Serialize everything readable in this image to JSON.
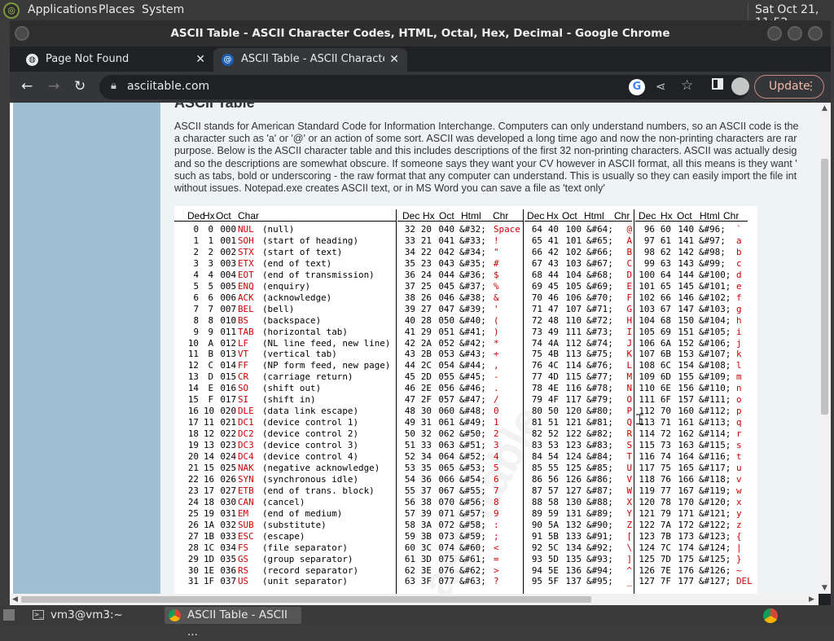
{
  "desktop": {
    "menus": [
      "Applications",
      "Places",
      "System"
    ],
    "clock": "Sat Oct 21, 11:52"
  },
  "window": {
    "title": "ASCII Table - ASCII Character Codes, HTML, Octal, Hex, Decimal - Google Chrome"
  },
  "tabs": [
    {
      "label": "Page Not Found",
      "close": "✕"
    },
    {
      "label": "ASCII Table - ASCII Character C",
      "close": "✕"
    }
  ],
  "newtab": "+",
  "omnibox": {
    "url": "asciitable.com"
  },
  "update_label": "Update",
  "page": {
    "heading": "ASCII Table",
    "intro": [
      "ASCII stands for American Standard Code for Information Interchange. Computers can only understand numbers, so an ASCII code is the",
      "a character such as 'a' or '@' or an action of some sort. ASCII was developed a long time ago and now the non-printing characters are rar",
      "purpose. Below is the ASCII character table and this includes descriptions of the first 32 non-printing characters. ASCII was actually desig",
      "and so the descriptions are somewhat obscure. If someone says they want your CV however in ASCII format, all this means is they want '",
      "such as tabs, bold or underscoring - the raw format that any computer can understand. This is usually so they can easily import the file int",
      "without issues. Notepad.exe creates ASCII text, or in MS Word you can save a file as 'text only'"
    ],
    "headers": [
      [
        "Dec",
        "Hx",
        "Oct",
        "Char"
      ],
      [
        "Dec",
        "Hx",
        "Oct",
        "Html",
        "Chr"
      ],
      [
        "Dec",
        "Hx",
        "Oct",
        "Html",
        "Chr"
      ],
      [
        "Dec",
        "Hx",
        "Oct",
        "Html",
        "Chr"
      ]
    ],
    "col1": [
      [
        "0",
        "0",
        "000",
        "NUL",
        "(null)"
      ],
      [
        "1",
        "1",
        "001",
        "SOH",
        "(start of heading)"
      ],
      [
        "2",
        "2",
        "002",
        "STX",
        "(start of text)"
      ],
      [
        "3",
        "3",
        "003",
        "ETX",
        "(end of text)"
      ],
      [
        "4",
        "4",
        "004",
        "EOT",
        "(end of transmission)"
      ],
      [
        "5",
        "5",
        "005",
        "ENQ",
        "(enquiry)"
      ],
      [
        "6",
        "6",
        "006",
        "ACK",
        "(acknowledge)"
      ],
      [
        "7",
        "7",
        "007",
        "BEL",
        "(bell)"
      ],
      [
        "8",
        "8",
        "010",
        "BS",
        "(backspace)"
      ],
      [
        "9",
        "9",
        "011",
        "TAB",
        "(horizontal tab)"
      ],
      [
        "10",
        "A",
        "012",
        "LF",
        "(NL line feed, new line)"
      ],
      [
        "11",
        "B",
        "013",
        "VT",
        "(vertical tab)"
      ],
      [
        "12",
        "C",
        "014",
        "FF",
        "(NP form feed, new page)"
      ],
      [
        "13",
        "D",
        "015",
        "CR",
        "(carriage return)"
      ],
      [
        "14",
        "E",
        "016",
        "SO",
        "(shift out)"
      ],
      [
        "15",
        "F",
        "017",
        "SI",
        "(shift in)"
      ],
      [
        "16",
        "10",
        "020",
        "DLE",
        "(data link escape)"
      ],
      [
        "17",
        "11",
        "021",
        "DC1",
        "(device control 1)"
      ],
      [
        "18",
        "12",
        "022",
        "DC2",
        "(device control 2)"
      ],
      [
        "19",
        "13",
        "023",
        "DC3",
        "(device control 3)"
      ],
      [
        "20",
        "14",
        "024",
        "DC4",
        "(device control 4)"
      ],
      [
        "21",
        "15",
        "025",
        "NAK",
        "(negative acknowledge)"
      ],
      [
        "22",
        "16",
        "026",
        "SYN",
        "(synchronous idle)"
      ],
      [
        "23",
        "17",
        "027",
        "ETB",
        "(end of trans. block)"
      ],
      [
        "24",
        "18",
        "030",
        "CAN",
        "(cancel)"
      ],
      [
        "25",
        "19",
        "031",
        "EM",
        "(end of medium)"
      ],
      [
        "26",
        "1A",
        "032",
        "SUB",
        "(substitute)"
      ],
      [
        "27",
        "1B",
        "033",
        "ESC",
        "(escape)"
      ],
      [
        "28",
        "1C",
        "034",
        "FS",
        "(file separator)"
      ],
      [
        "29",
        "1D",
        "035",
        "GS",
        "(group separator)"
      ],
      [
        "30",
        "1E",
        "036",
        "RS",
        "(record separator)"
      ],
      [
        "31",
        "1F",
        "037",
        "US",
        "(unit separator)"
      ]
    ],
    "col2": [
      [
        "32",
        "20",
        "040",
        "&#32;",
        "Space"
      ],
      [
        "33",
        "21",
        "041",
        "&#33;",
        "!"
      ],
      [
        "34",
        "22",
        "042",
        "&#34;",
        "\""
      ],
      [
        "35",
        "23",
        "043",
        "&#35;",
        "#"
      ],
      [
        "36",
        "24",
        "044",
        "&#36;",
        "$"
      ],
      [
        "37",
        "25",
        "045",
        "&#37;",
        "%"
      ],
      [
        "38",
        "26",
        "046",
        "&#38;",
        "&"
      ],
      [
        "39",
        "27",
        "047",
        "&#39;",
        "'"
      ],
      [
        "40",
        "28",
        "050",
        "&#40;",
        "("
      ],
      [
        "41",
        "29",
        "051",
        "&#41;",
        ")"
      ],
      [
        "42",
        "2A",
        "052",
        "&#42;",
        "*"
      ],
      [
        "43",
        "2B",
        "053",
        "&#43;",
        "+"
      ],
      [
        "44",
        "2C",
        "054",
        "&#44;",
        ","
      ],
      [
        "45",
        "2D",
        "055",
        "&#45;",
        "-"
      ],
      [
        "46",
        "2E",
        "056",
        "&#46;",
        "."
      ],
      [
        "47",
        "2F",
        "057",
        "&#47;",
        "/"
      ],
      [
        "48",
        "30",
        "060",
        "&#48;",
        "0"
      ],
      [
        "49",
        "31",
        "061",
        "&#49;",
        "1"
      ],
      [
        "50",
        "32",
        "062",
        "&#50;",
        "2"
      ],
      [
        "51",
        "33",
        "063",
        "&#51;",
        "3"
      ],
      [
        "52",
        "34",
        "064",
        "&#52;",
        "4"
      ],
      [
        "53",
        "35",
        "065",
        "&#53;",
        "5"
      ],
      [
        "54",
        "36",
        "066",
        "&#54;",
        "6"
      ],
      [
        "55",
        "37",
        "067",
        "&#55;",
        "7"
      ],
      [
        "56",
        "38",
        "070",
        "&#56;",
        "8"
      ],
      [
        "57",
        "39",
        "071",
        "&#57;",
        "9"
      ],
      [
        "58",
        "3A",
        "072",
        "&#58;",
        ":"
      ],
      [
        "59",
        "3B",
        "073",
        "&#59;",
        ";"
      ],
      [
        "60",
        "3C",
        "074",
        "&#60;",
        "<"
      ],
      [
        "61",
        "3D",
        "075",
        "&#61;",
        "="
      ],
      [
        "62",
        "3E",
        "076",
        "&#62;",
        ">"
      ],
      [
        "63",
        "3F",
        "077",
        "&#63;",
        "?"
      ]
    ],
    "col3": [
      [
        "64",
        "40",
        "100",
        "&#64;",
        "@"
      ],
      [
        "65",
        "41",
        "101",
        "&#65;",
        "A"
      ],
      [
        "66",
        "42",
        "102",
        "&#66;",
        "B"
      ],
      [
        "67",
        "43",
        "103",
        "&#67;",
        "C"
      ],
      [
        "68",
        "44",
        "104",
        "&#68;",
        "D"
      ],
      [
        "69",
        "45",
        "105",
        "&#69;",
        "E"
      ],
      [
        "70",
        "46",
        "106",
        "&#70;",
        "F"
      ],
      [
        "71",
        "47",
        "107",
        "&#71;",
        "G"
      ],
      [
        "72",
        "48",
        "110",
        "&#72;",
        "H"
      ],
      [
        "73",
        "49",
        "111",
        "&#73;",
        "I"
      ],
      [
        "74",
        "4A",
        "112",
        "&#74;",
        "J"
      ],
      [
        "75",
        "4B",
        "113",
        "&#75;",
        "K"
      ],
      [
        "76",
        "4C",
        "114",
        "&#76;",
        "L"
      ],
      [
        "77",
        "4D",
        "115",
        "&#77;",
        "M"
      ],
      [
        "78",
        "4E",
        "116",
        "&#78;",
        "N"
      ],
      [
        "79",
        "4F",
        "117",
        "&#79;",
        "O"
      ],
      [
        "80",
        "50",
        "120",
        "&#80;",
        "P"
      ],
      [
        "81",
        "51",
        "121",
        "&#81;",
        "Q"
      ],
      [
        "82",
        "52",
        "122",
        "&#82;",
        "R"
      ],
      [
        "83",
        "53",
        "123",
        "&#83;",
        "S"
      ],
      [
        "84",
        "54",
        "124",
        "&#84;",
        "T"
      ],
      [
        "85",
        "55",
        "125",
        "&#85;",
        "U"
      ],
      [
        "86",
        "56",
        "126",
        "&#86;",
        "V"
      ],
      [
        "87",
        "57",
        "127",
        "&#87;",
        "W"
      ],
      [
        "88",
        "58",
        "130",
        "&#88;",
        "X"
      ],
      [
        "89",
        "59",
        "131",
        "&#89;",
        "Y"
      ],
      [
        "90",
        "5A",
        "132",
        "&#90;",
        "Z"
      ],
      [
        "91",
        "5B",
        "133",
        "&#91;",
        "["
      ],
      [
        "92",
        "5C",
        "134",
        "&#92;",
        "\\"
      ],
      [
        "93",
        "5D",
        "135",
        "&#93;",
        "]"
      ],
      [
        "94",
        "5E",
        "136",
        "&#94;",
        "^"
      ],
      [
        "95",
        "5F",
        "137",
        "&#95;",
        "_"
      ]
    ],
    "col4": [
      [
        "96",
        "60",
        "140",
        "&#96;",
        "`"
      ],
      [
        "97",
        "61",
        "141",
        "&#97;",
        "a"
      ],
      [
        "98",
        "62",
        "142",
        "&#98;",
        "b"
      ],
      [
        "99",
        "63",
        "143",
        "&#99;",
        "c"
      ],
      [
        "100",
        "64",
        "144",
        "&#100;",
        "d"
      ],
      [
        "101",
        "65",
        "145",
        "&#101;",
        "e"
      ],
      [
        "102",
        "66",
        "146",
        "&#102;",
        "f"
      ],
      [
        "103",
        "67",
        "147",
        "&#103;",
        "g"
      ],
      [
        "104",
        "68",
        "150",
        "&#104;",
        "h"
      ],
      [
        "105",
        "69",
        "151",
        "&#105;",
        "i"
      ],
      [
        "106",
        "6A",
        "152",
        "&#106;",
        "j"
      ],
      [
        "107",
        "6B",
        "153",
        "&#107;",
        "k"
      ],
      [
        "108",
        "6C",
        "154",
        "&#108;",
        "l"
      ],
      [
        "109",
        "6D",
        "155",
        "&#109;",
        "m"
      ],
      [
        "110",
        "6E",
        "156",
        "&#110;",
        "n"
      ],
      [
        "111",
        "6F",
        "157",
        "&#111;",
        "o"
      ],
      [
        "112",
        "70",
        "160",
        "&#112;",
        "p"
      ],
      [
        "113",
        "71",
        "161",
        "&#113;",
        "q"
      ],
      [
        "114",
        "72",
        "162",
        "&#114;",
        "r"
      ],
      [
        "115",
        "73",
        "163",
        "&#115;",
        "s"
      ],
      [
        "116",
        "74",
        "164",
        "&#116;",
        "t"
      ],
      [
        "117",
        "75",
        "165",
        "&#117;",
        "u"
      ],
      [
        "118",
        "76",
        "166",
        "&#118;",
        "v"
      ],
      [
        "119",
        "77",
        "167",
        "&#119;",
        "w"
      ],
      [
        "120",
        "78",
        "170",
        "&#120;",
        "x"
      ],
      [
        "121",
        "79",
        "171",
        "&#121;",
        "y"
      ],
      [
        "122",
        "7A",
        "172",
        "&#122;",
        "z"
      ],
      [
        "123",
        "7B",
        "173",
        "&#123;",
        "{"
      ],
      [
        "124",
        "7C",
        "174",
        "&#124;",
        "|"
      ],
      [
        "125",
        "7D",
        "175",
        "&#125;",
        "}"
      ],
      [
        "126",
        "7E",
        "176",
        "&#126;",
        "~"
      ],
      [
        "127",
        "7F",
        "177",
        "&#127;",
        "DEL"
      ]
    ]
  },
  "taskbar": [
    {
      "label": "vm3@vm3:~"
    },
    {
      "label": "ASCII Table - ASCII ..."
    }
  ],
  "colors": {
    "accent_red": "#cc0000",
    "sidebar": "#9fbfd4",
    "page_bg": "#eef3f6",
    "chrome_dark": "#202124",
    "chrome_toolbar": "#35363a",
    "update_border": "#c58a7b"
  }
}
